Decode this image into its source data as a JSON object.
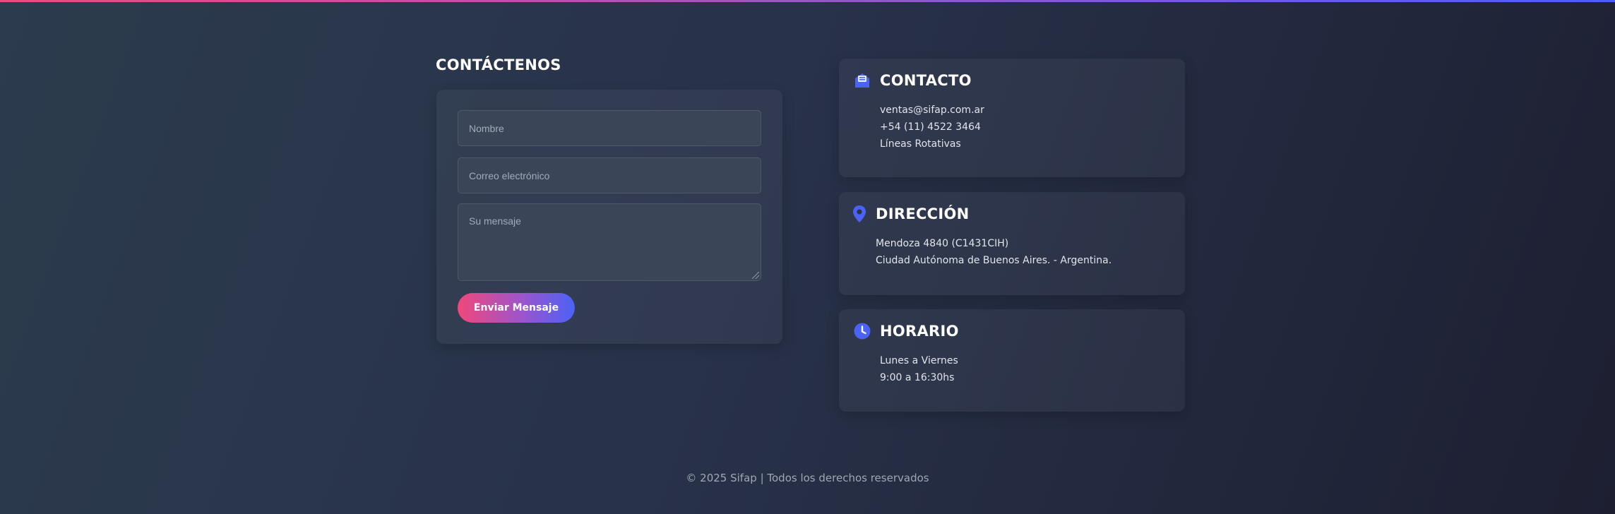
{
  "contact_form": {
    "title": "CONTÁCTENOS",
    "name_placeholder": "Nombre",
    "email_placeholder": "Correo electrónico",
    "message_placeholder": "Su mensaje",
    "submit_label": "Enviar Mensaje"
  },
  "contact_card": {
    "icon": "envelope-icon",
    "title": "CONTACTO",
    "email": "ventas@sifap.com.ar",
    "phone": "+54 (11) 4522 3464",
    "lines_note": "Líneas Rotativas"
  },
  "address_card": {
    "icon": "map-pin-icon",
    "title": "DIRECCIÓN",
    "street": "Mendoza 4840 (C1431CIH)",
    "city": "Ciudad Autónoma de Buenos Aires. - Argentina."
  },
  "hours_card": {
    "icon": "clock-icon",
    "title": "HORARIO",
    "days": "Lunes a Viernes",
    "time": "9:00 a 16:30hs"
  },
  "footer": {
    "copyright": "© 2025 Sifap | Todos los derechos reservados"
  },
  "colors": {
    "accent_blue": "#4b62f6",
    "accent_pink": "#f1477a"
  }
}
